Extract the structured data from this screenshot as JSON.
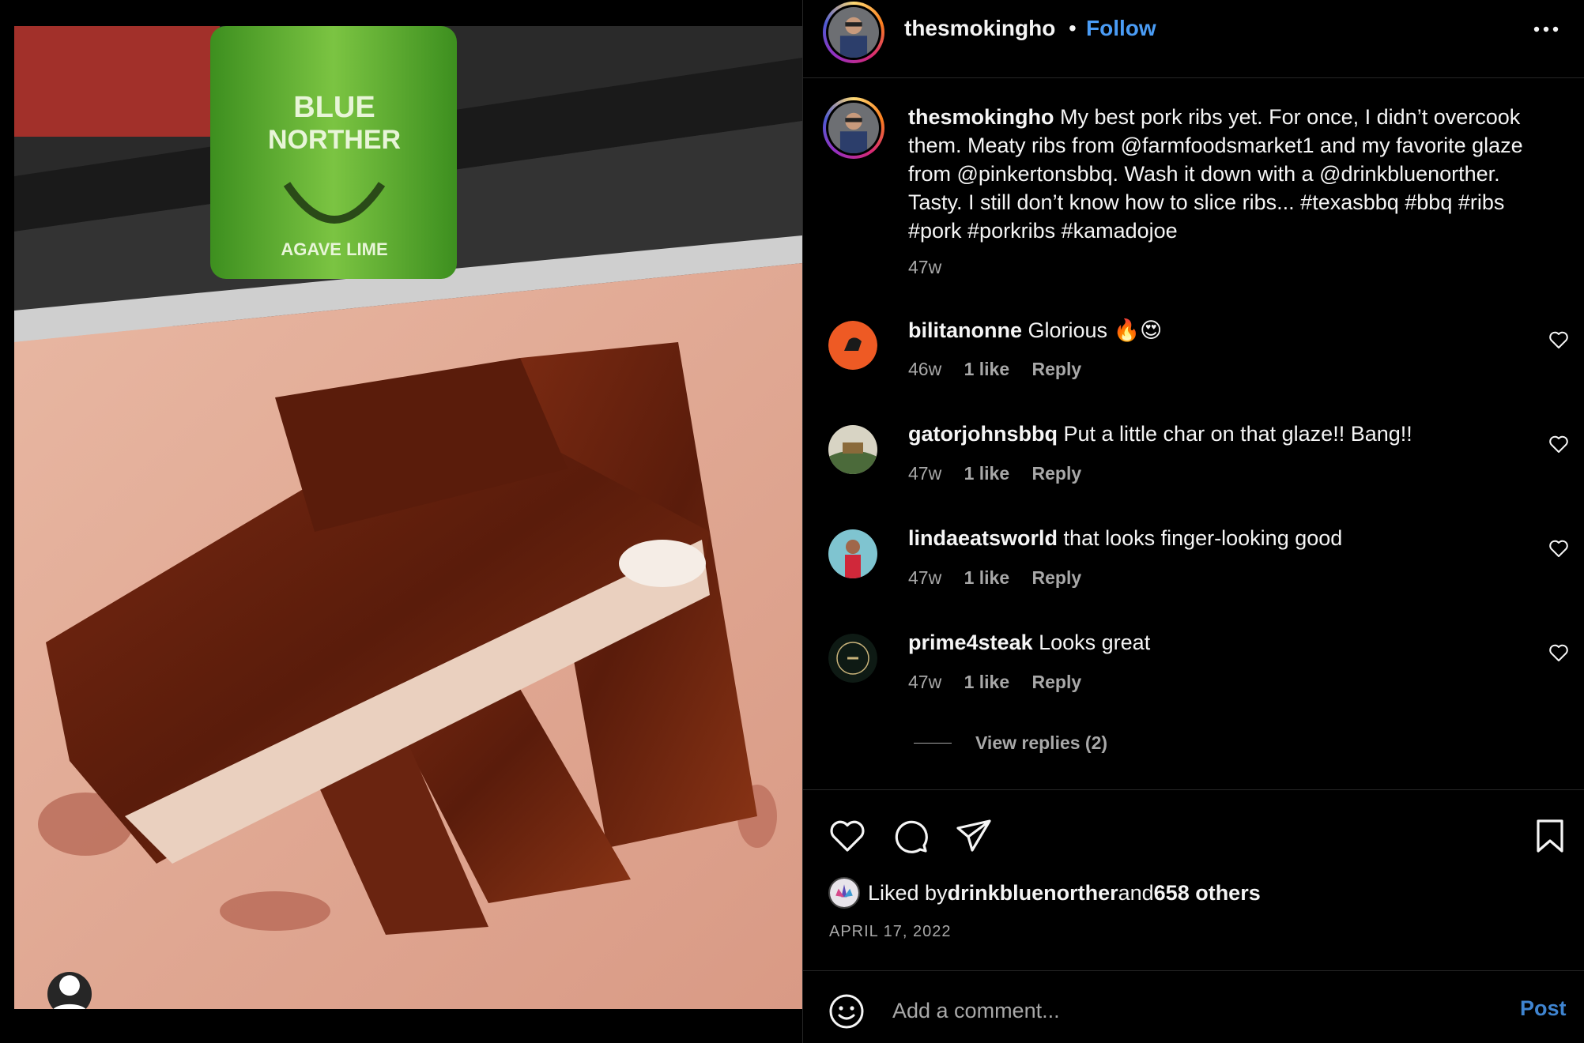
{
  "post": {
    "username": "thesmokingho",
    "separator": "•",
    "follow_label": "Follow",
    "more_icon": "more-options-icon",
    "caption_username": "thesmokingho",
    "caption_text": " My best pork ribs yet. For once, I didn’t overcook them. Meaty ribs from @farmfoodsmarket1 and my favorite glaze from @pinkertonsbbq. Wash it down with a @drinkbluenorther. Tasty. I still don’t know how to slice ribs... #texasbbq #bbq #ribs #pork #porkribs #kamadojoe",
    "caption_time": "47w"
  },
  "image": {
    "can_line1": "BLUE",
    "can_line2": "NORTHER",
    "can_flavor": "AGAVE LIME"
  },
  "comments": [
    {
      "username": "bilitanonne",
      "text": " Glorious 🔥😍",
      "time": "46w",
      "likes": "1 like",
      "reply": "Reply"
    },
    {
      "username": "gatorjohnsbbq",
      "text": " Put a little char on that glaze!! Bang!!",
      "time": "47w",
      "likes": "1 like",
      "reply": "Reply"
    },
    {
      "username": "lindaeatsworld",
      "text": " that looks finger-looking good",
      "time": "47w",
      "likes": "1 like",
      "reply": "Reply"
    },
    {
      "username": "prime4steak",
      "text": " Looks great",
      "time": "47w",
      "likes": "1 like",
      "reply": "Reply"
    }
  ],
  "view_replies": "View replies (2)",
  "likes": {
    "prefix": "Liked by ",
    "user": "drinkbluenorther",
    "middle": " and ",
    "others": "658 others"
  },
  "date": "APRIL 17, 2022",
  "add_comment": {
    "placeholder": "Add a comment...",
    "post_label": "Post"
  },
  "colors": {
    "accent": "#4a9cf5",
    "secondary_text": "#a8a8a8",
    "background": "#000000"
  }
}
